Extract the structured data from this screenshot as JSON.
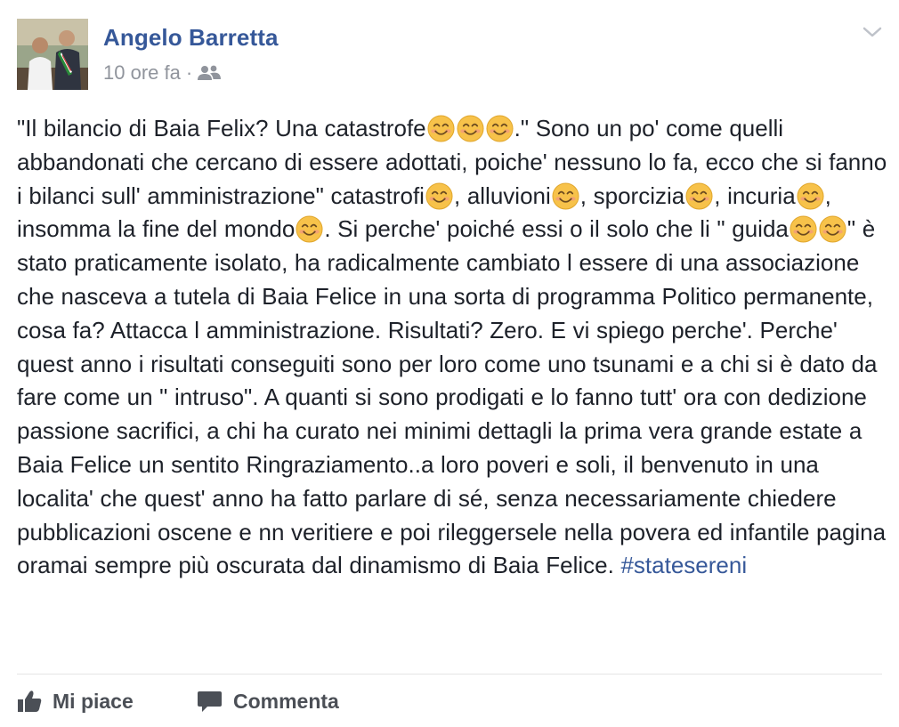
{
  "post": {
    "author": "Angelo Barretta",
    "time": "10 ore fa",
    "separator": "·",
    "audience_icon": "friends-icon",
    "text_segments": [
      {
        "t": "\"Il bilancio di Baia Felix? Una catastrofe"
      },
      {
        "e": "smiling-face-icon"
      },
      {
        "e": "smiling-face-icon"
      },
      {
        "e": "smiling-face-icon"
      },
      {
        "t": ".\" Sono un po' come quelli abbandonati che cercano di essere adottati, poiche' nessuno lo fa, ecco che si fanno i bilanci sull' amministrazione\" catastrofi"
      },
      {
        "e": "smiling-face-icon"
      },
      {
        "t": ", alluvioni"
      },
      {
        "e": "smiling-face-icon"
      },
      {
        "t": ", sporcizia"
      },
      {
        "e": "smiling-face-icon"
      },
      {
        "t": ", incuria"
      },
      {
        "e": "smiling-face-icon"
      },
      {
        "t": ", insomma la fine del mondo"
      },
      {
        "e": "smiling-face-icon"
      },
      {
        "t": ". Si perche' poiché essi o il solo che li \" guida"
      },
      {
        "e": "smiling-face-icon"
      },
      {
        "e": "smiling-face-icon"
      },
      {
        "t": "\" è stato praticamente isolato, ha radicalmente cambiato l essere di una associazione che nasceva a tutela di Baia Felice in una sorta di programma Politico permanente, cosa fa? Attacca l amministrazione. Risultati? Zero. E vi spiego perche'. Perche' quest anno i risultati conseguiti sono per loro come uno tsunami e a chi si è dato da fare come un \" intruso\". A quanti si sono prodigati e lo fanno tutt' ora con dedizione passione sacrifici, a chi ha curato nei minimi dettagli la prima vera grande estate a Baia Felice un sentito Ringraziamento..a loro poveri e soli, il benvenuto in una localita' che quest' anno ha fatto parlare di sé, senza necessariamente chiedere pubblicazioni oscene e nn veritiere e poi rileggersele nella povera ed infantile pagina oramai sempre più oscurata dal dinamismo di Baia Felice. "
      },
      {
        "h": "#statesereni"
      }
    ]
  },
  "actions": {
    "like_label": "Mi piace",
    "comment_label": "Commenta"
  },
  "colors": {
    "link": "#365899",
    "text": "#1d2129",
    "meta": "#90949c",
    "action": "#4b4f56",
    "emoji_face": "#f7c24a"
  }
}
